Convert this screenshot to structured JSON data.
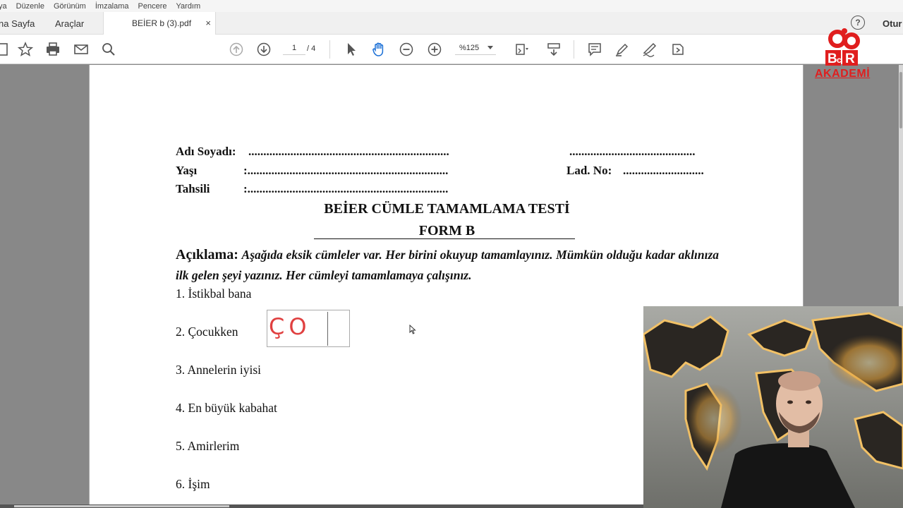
{
  "menu": {
    "items": [
      "ya",
      "Düzenle",
      "Görünüm",
      "İmzalama",
      "Pencere",
      "Yardım"
    ]
  },
  "tabs": {
    "home": "na Sayfa",
    "tools": "Araçlar",
    "document": "BEİER b (3).pdf",
    "close_symbol": "×"
  },
  "header": {
    "signin": "Otur",
    "help_symbol": "?"
  },
  "toolbar": {
    "current_page": "1",
    "page_total": "/ 4",
    "zoom": "%125"
  },
  "logo": {
    "mark": "BcR",
    "text": "AKADEMİ",
    "color": "#e01e1e"
  },
  "document": {
    "name_label": "Adı Soyadı:",
    "name_dots": "...................................................................",
    "right_dots": "..........................................",
    "age_label": "Yaşı",
    "age_dots": ":...................................................................",
    "lad_label": "Lad. No:",
    "lad_dots": "...........................",
    "education_label": "Tahsili",
    "education_dots": ":...................................................................",
    "title": "BEİER CÜMLE TAMAMLAMA TESTİ",
    "subtitle": "FORM B",
    "desc_label": "Açıklama:",
    "desc_text": "Aşağıda eksik cümleler var. Her birini okuyup tamamlayınız. Mümkün olduğu kadar aklınıza ilk gelen şeyi yazınız. Her cümleyi tamamlamaya çalışınız.",
    "items": [
      "1. İstikbal bana",
      "2. Çocukken",
      "3. Annelerin iyisi",
      "4. En büyük kabahat",
      "5. Amirlerim",
      "6. İşim"
    ],
    "answer_text": "ÇO",
    "answer_color": "#e04040"
  }
}
